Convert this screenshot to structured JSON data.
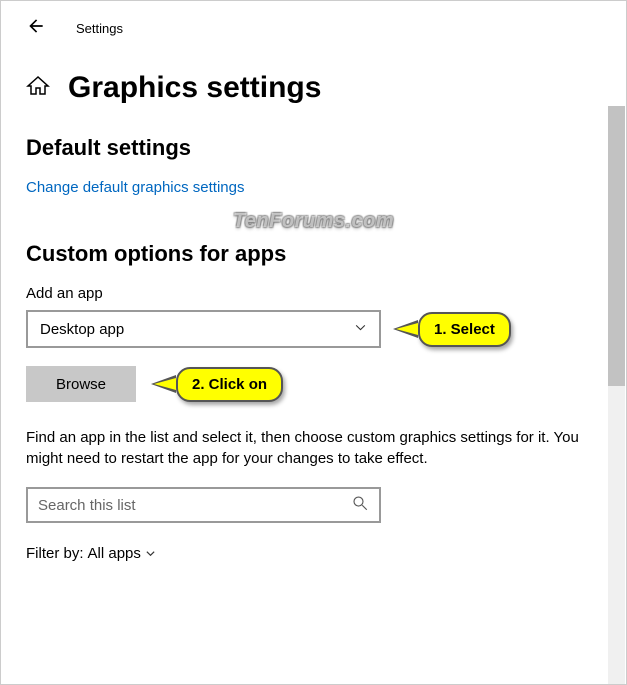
{
  "header": {
    "title": "Settings"
  },
  "page": {
    "title": "Graphics settings"
  },
  "default_section": {
    "heading": "Default settings",
    "link": "Change default graphics settings"
  },
  "watermark": "TenForums.com",
  "custom_section": {
    "heading": "Custom options for apps",
    "add_label": "Add an app",
    "dropdown_value": "Desktop app",
    "browse_label": "Browse",
    "info": "Find an app in the list and select it, then choose custom graphics settings for it. You might need to restart the app for your changes to take effect.",
    "search_placeholder": "Search this list"
  },
  "filter": {
    "label": "Filter by:",
    "value": "All apps"
  },
  "callouts": {
    "select": "1. Select",
    "click": "2. Click on"
  }
}
